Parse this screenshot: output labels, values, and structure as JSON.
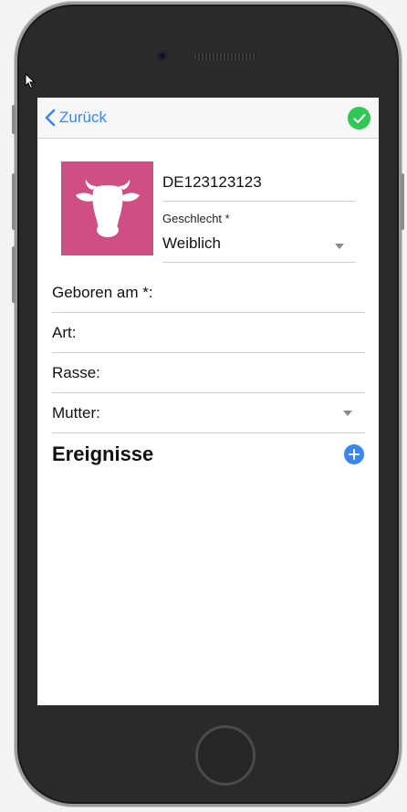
{
  "device": {
    "name": "iPhone",
    "frame_color": "#2a2a2a"
  },
  "navbar": {
    "back_label": "Zurück",
    "back_icon": "chevron-left-icon",
    "save_icon": "checkmark-icon",
    "accent": "#3b87f0",
    "save_color": "#2fc854"
  },
  "animal": {
    "avatar_icon": "cow-head-icon",
    "avatar_color": "#cf4f85",
    "id_value": "DE123123123",
    "gender_label": "Geschlecht *",
    "gender_value": "Weiblich"
  },
  "fields": {
    "born_label": "Geboren am *:",
    "type_label": "Art:",
    "breed_label": "Rasse:",
    "mother_label": "Mutter:"
  },
  "events": {
    "title": "Ereignisse",
    "add_icon": "plus-icon"
  }
}
